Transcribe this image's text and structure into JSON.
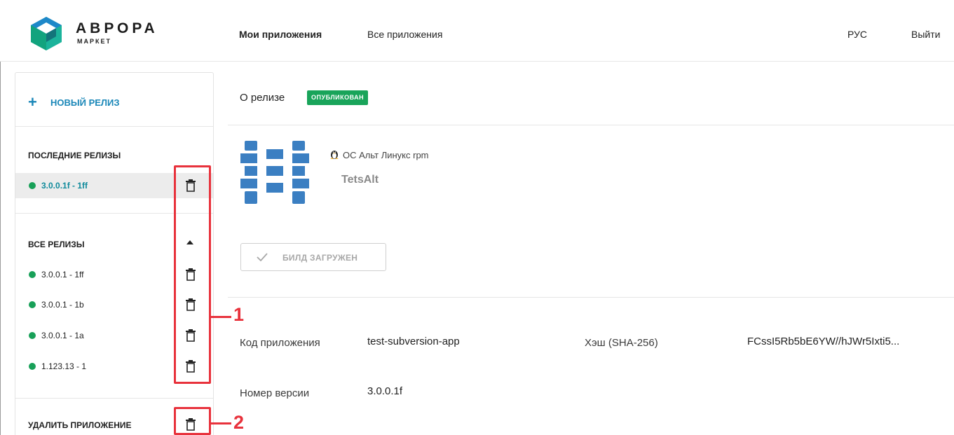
{
  "header": {
    "brand_name": "АВРОРА",
    "brand_sub": "МАРКЕТ",
    "nav": [
      {
        "label": "Мои приложения"
      },
      {
        "label": "Все приложения"
      }
    ],
    "lang": "РУС",
    "logout": "Выйти"
  },
  "sidebar": {
    "new_release": "НОВЫЙ РЕЛИЗ",
    "latest_heading": "ПОСЛЕДНИЕ РЕЛИЗЫ",
    "latest": [
      {
        "label": "3.0.0.1f - 1ff"
      }
    ],
    "all_heading": "ВСЕ РЕЛИЗЫ",
    "all": [
      {
        "label": "3.0.0.1 - 1ff"
      },
      {
        "label": "3.0.0.1 - 1b"
      },
      {
        "label": "3.0.0.1 - 1a"
      },
      {
        "label": "1.123.13 - 1"
      }
    ],
    "delete_app": "УДАЛИТЬ ПРИЛОЖЕНИЕ"
  },
  "annotations": {
    "one": "1",
    "two": "2"
  },
  "main": {
    "title": "О релизе",
    "status": "ОПУБЛИКОВАН",
    "os_label": "ОС Альт Линукс rpm",
    "app_name": "TetsAlt",
    "build_label": "БИЛД ЗАГРУЖЕН",
    "fields": {
      "code_label": "Код приложения",
      "code_value": "test-subversion-app",
      "hash_label": "Хэш (SHA-256)",
      "hash_value": "FCssI5Rb5bE6YW//hJWr5Ixti5...",
      "version_label": "Номер версии",
      "version_value": "3.0.0.1f"
    }
  },
  "colors": {
    "accent": "#1a87b8",
    "status_green": "#19a45a",
    "annotation_red": "#e8323c",
    "app_icon_blue": "#3b7fc2"
  },
  "icons": [
    "logo-icon",
    "plus-icon",
    "trash-icon",
    "caret-up-icon",
    "app-icon",
    "linux-icon",
    "check-icon"
  ]
}
